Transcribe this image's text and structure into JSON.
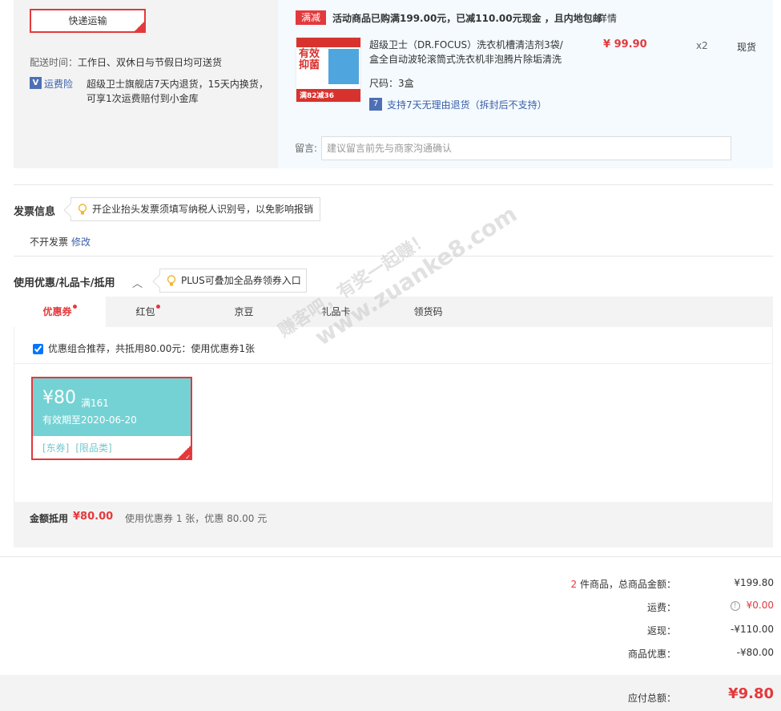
{
  "shipping": {
    "method": "快递运输",
    "delivery_label": "配送时间：",
    "delivery_value": "工作日、双休日与节假日均可送货",
    "insurance_icon": "shield-icon",
    "insurance_link": "运费险",
    "insurance_desc": "超级卫士旗舰店7天内退货，15天内换货，可享1次运费赔付到小金库"
  },
  "goods": {
    "promo_tag": "满减",
    "promo_text": "活动商品已购满199.00元，已减110.00元现金 ，且内地包邮",
    "promo_more": "详情",
    "image_text_top": "有效抑菌",
    "image_text_bottom": "满82减36",
    "name": "超级卫士（DR.FOCUS）洗衣机槽清洁剂3袋/盒全自动波轮滚筒式洗衣机非泡腾片除垢清洗",
    "price": "¥ 99.90",
    "qty": "x2",
    "stock": "现货",
    "size": "尺码：3盒",
    "return_icon": "7",
    "return_text": "支持7天无理由退货（拆封后不支持）",
    "remark_label": "留言:",
    "remark_placeholder": "建议留言前先与商家沟通确认"
  },
  "invoice": {
    "title": "发票信息",
    "tip": "开企业抬头发票须填写纳税人识别号，以免影响报销",
    "value": "不开发票",
    "edit": "修改"
  },
  "coupon": {
    "title": "使用优惠/礼品卡/抵用",
    "tip": "PLUS可叠加全品券领券入口",
    "tabs": [
      {
        "label": "优惠券",
        "dot": true
      },
      {
        "label": "红包",
        "dot": true
      },
      {
        "label": "京豆",
        "dot": false
      },
      {
        "label": "礼品卡",
        "dot": false
      },
      {
        "label": "领货码",
        "dot": false
      }
    ],
    "combo_text": "优惠组合推荐，共抵用80.00元：使用优惠券1张",
    "card": {
      "amount": "¥80",
      "condition": "满161",
      "valid": "有效期至2020-06-20",
      "tags": [
        "[东券]",
        "[限品类]"
      ]
    },
    "deduct_label": "金额抵用",
    "deduct_value": "¥80.00",
    "deduct_desc": "使用优惠券 1 张，优惠 80.00 元"
  },
  "summary": {
    "count": "2",
    "count_label": "件商品，总商品金额：",
    "goods_total": "¥199.80",
    "freight_label": "运费：",
    "freight_icon": "!",
    "freight_value": "¥0.00",
    "cashback_label": "返现：",
    "cashback_value": "-¥110.00",
    "discount_label": "商品优惠：",
    "discount_value": "-¥80.00",
    "payable_label": "应付总额：",
    "payable_value": "¥9.80"
  },
  "watermark": {
    "line1": "赚客吧，有奖一起赚！",
    "line2": "www.zuanke8.com"
  },
  "colors": {
    "accent": "#e4393c",
    "link": "#3a5fa8",
    "coupon": "#74d2d4"
  }
}
